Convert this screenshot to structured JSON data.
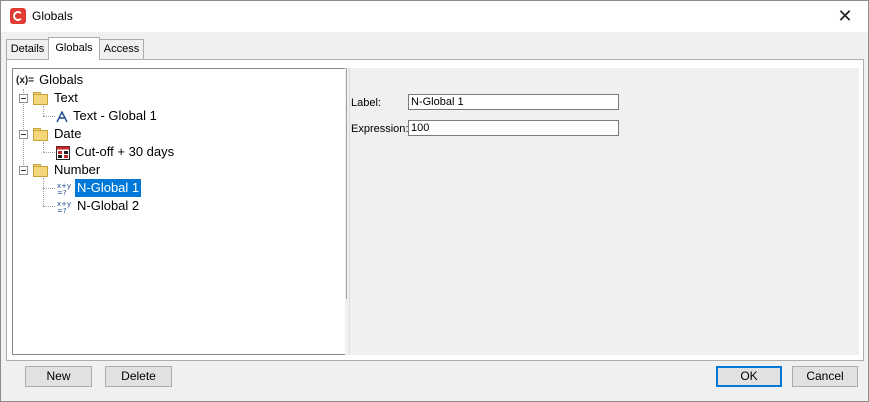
{
  "window": {
    "title": "Globals",
    "close_glyph": "✕"
  },
  "tabs": [
    {
      "label": "Details"
    },
    {
      "label": "Globals"
    },
    {
      "label": "Access"
    }
  ],
  "tree": {
    "root": "Globals",
    "root_icon_glyph": "(x)=",
    "groups": [
      {
        "label": "Text",
        "items": [
          {
            "label": "Text - Global 1"
          }
        ]
      },
      {
        "label": "Date",
        "items": [
          {
            "label": "Cut-off + 30 days"
          }
        ]
      },
      {
        "label": "Number",
        "items": [
          {
            "label": "N-Global 1"
          },
          {
            "label": "N-Global 2"
          }
        ]
      }
    ]
  },
  "form": {
    "label_caption": "Label:",
    "label_value": "N-Global 1",
    "expression_caption": "Expression:",
    "expression_value": "100"
  },
  "buttons": {
    "new": "New",
    "delete": "Delete",
    "ok": "OK",
    "cancel": "Cancel"
  },
  "colors": {
    "selection": "#0078d7",
    "app_icon": "#e03c31"
  }
}
